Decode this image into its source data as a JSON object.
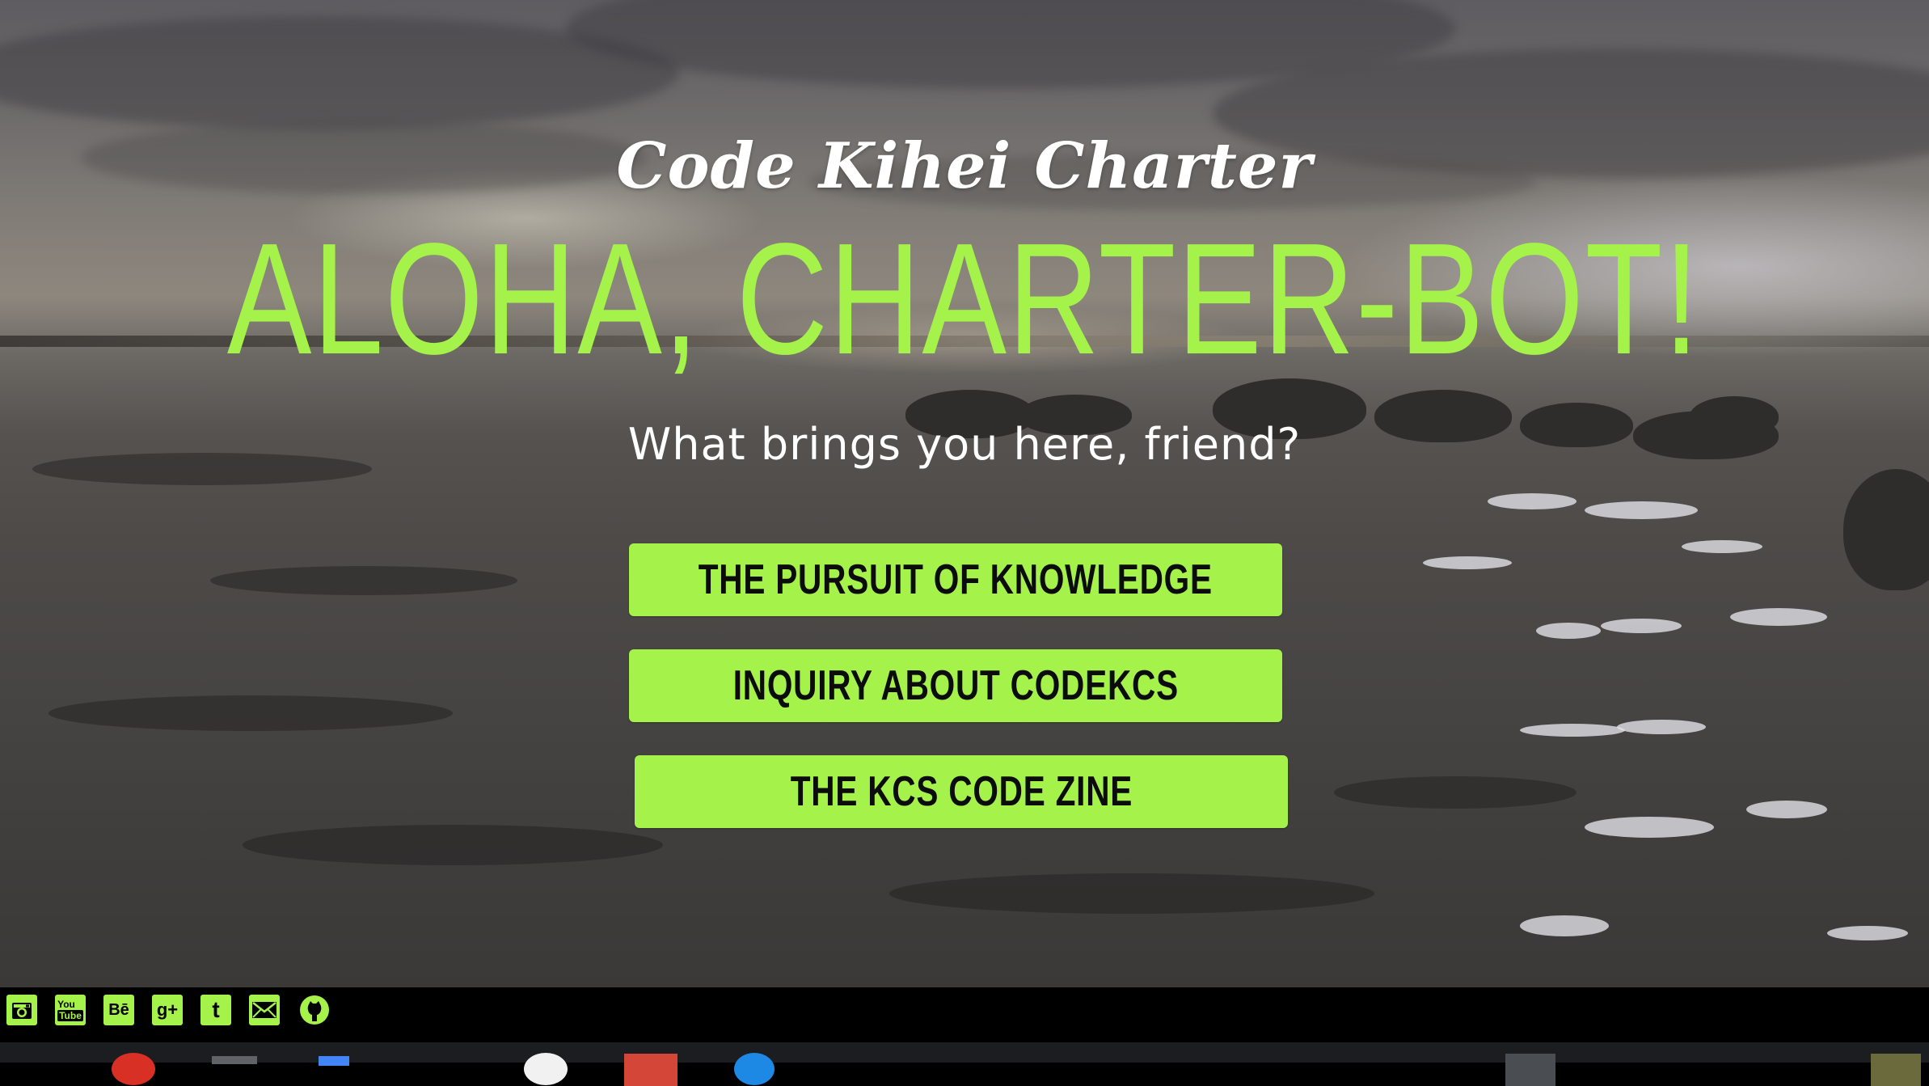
{
  "colors": {
    "accent": "#a5f24a",
    "text_light": "#ffffff",
    "button_text": "#0c0c0c",
    "social_bar_bg": "#000000"
  },
  "hero": {
    "script_title": "Code Kihei Charter",
    "big_title": "ALOHA, CHARTER-BOT!",
    "subtitle": "What brings you here, friend?"
  },
  "buttons": [
    {
      "label": "THE PURSUIT OF KNOWLEDGE"
    },
    {
      "label": "INQUIRY ABOUT CODEKCS"
    },
    {
      "label": "THE KCS CODE ZINE"
    }
  ],
  "social": [
    {
      "icon": "instagram-icon",
      "glyph": ""
    },
    {
      "icon": "youtube-icon",
      "glyph": "You Tube"
    },
    {
      "icon": "behance-icon",
      "glyph": "Bē"
    },
    {
      "icon": "google-plus-icon",
      "glyph": "g+"
    },
    {
      "icon": "tumblr-icon",
      "glyph": "t"
    },
    {
      "icon": "email-icon",
      "glyph": ""
    },
    {
      "icon": "github-icon",
      "glyph": ""
    }
  ],
  "taskbar": [
    {
      "icon": "chrome-icon",
      "color": "#d93025"
    },
    {
      "icon": "files-icon",
      "color": "#5f6368"
    },
    {
      "icon": "docs-icon",
      "color": "#4285f4"
    },
    {
      "icon": "app-circle-icon",
      "color": "#f1f1f1"
    },
    {
      "icon": "gmail-icon",
      "color": "#d44638"
    },
    {
      "icon": "app-blue-icon",
      "color": "#1e88e5"
    },
    {
      "icon": "window-icon",
      "color": "#4a4d52"
    },
    {
      "icon": "avatar-icon",
      "color": "#6b6a3d"
    }
  ]
}
